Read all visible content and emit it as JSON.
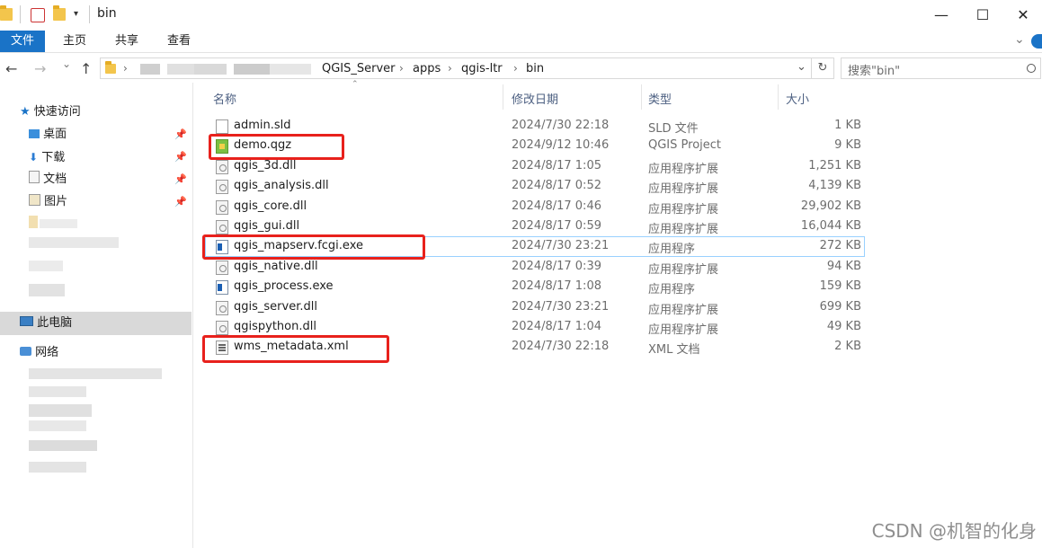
{
  "window": {
    "title": "bin",
    "controls": {
      "minimize": "—",
      "maximize": "☐",
      "close": "✕"
    }
  },
  "ribbon": {
    "tabs": [
      "文件",
      "主页",
      "共享",
      "查看"
    ]
  },
  "nav": {
    "back_icon": "←",
    "forward_icon": "→",
    "dropdown_icon": "⌄",
    "up_icon": "↑",
    "breadcrumb": [
      "QGIS_Server",
      "apps",
      "qgis-ltr",
      "bin"
    ],
    "refresh_icon": "↻",
    "search_placeholder": "搜索\"bin\""
  },
  "sidebar": {
    "quick_access": "快速访问",
    "pinned": [
      "桌面",
      "下载",
      "文档",
      "图片"
    ],
    "this_pc": "此电脑",
    "network": "网络"
  },
  "columns": {
    "name": "名称",
    "date": "修改日期",
    "type": "类型",
    "size": "大小"
  },
  "files": [
    {
      "name": "admin.sld",
      "date": "2024/7/30 22:18",
      "type": "SLD 文件",
      "size": "1 KB",
      "icon": "sld-file-icon"
    },
    {
      "name": "demo.qgz",
      "date": "2024/9/12 10:46",
      "type": "QGIS Project",
      "size": "9 KB",
      "icon": "qgis-project-icon"
    },
    {
      "name": "qgis_3d.dll",
      "date": "2024/8/17 1:05",
      "type": "应用程序扩展",
      "size": "1,251 KB",
      "icon": "dll-icon"
    },
    {
      "name": "qgis_analysis.dll",
      "date": "2024/8/17 0:52",
      "type": "应用程序扩展",
      "size": "4,139 KB",
      "icon": "dll-icon"
    },
    {
      "name": "qgis_core.dll",
      "date": "2024/8/17 0:46",
      "type": "应用程序扩展",
      "size": "29,902 KB",
      "icon": "dll-icon"
    },
    {
      "name": "qgis_gui.dll",
      "date": "2024/8/17 0:59",
      "type": "应用程序扩展",
      "size": "16,044 KB",
      "icon": "dll-icon"
    },
    {
      "name": "qgis_mapserv.fcgi.exe",
      "date": "2024/7/30 23:21",
      "type": "应用程序",
      "size": "272 KB",
      "icon": "exe-icon"
    },
    {
      "name": "qgis_native.dll",
      "date": "2024/8/17 0:39",
      "type": "应用程序扩展",
      "size": "94 KB",
      "icon": "dll-icon"
    },
    {
      "name": "qgis_process.exe",
      "date": "2024/8/17 1:08",
      "type": "应用程序",
      "size": "159 KB",
      "icon": "exe-icon"
    },
    {
      "name": "qgis_server.dll",
      "date": "2024/7/30 23:21",
      "type": "应用程序扩展",
      "size": "699 KB",
      "icon": "dll-icon"
    },
    {
      "name": "qgispython.dll",
      "date": "2024/8/17 1:04",
      "type": "应用程序扩展",
      "size": "49 KB",
      "icon": "dll-icon"
    },
    {
      "name": "wms_metadata.xml",
      "date": "2024/7/30 22:18",
      "type": "XML 文档",
      "size": "2 KB",
      "icon": "xml-file-icon"
    }
  ],
  "highlight_color": "#e8211c",
  "accent_color": "#1a73c7",
  "watermark": "CSDN @机智的化身"
}
